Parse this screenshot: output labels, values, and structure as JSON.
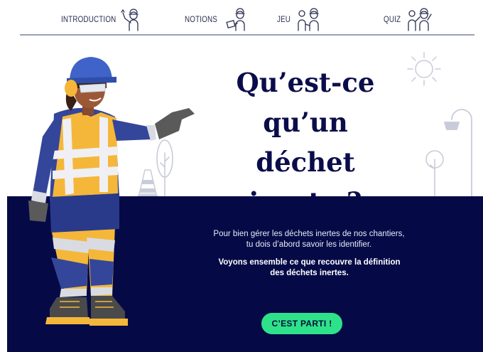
{
  "nav": {
    "items": [
      {
        "label": "INTRODUCTION",
        "icon": "worker-waving-icon"
      },
      {
        "label": "NOTIONS",
        "icon": "worker-clipboard-icon"
      },
      {
        "label": "JEU",
        "icon": "workers-game-icon"
      },
      {
        "label": "QUIZ",
        "icon": "workers-quiz-icon"
      }
    ]
  },
  "hero": {
    "title_line1": "Qu’est-ce",
    "title_line2": "qu’un déchet",
    "title_line3": "inerte ?"
  },
  "band": {
    "intro_line1": "Pour bien gérer les déchets inertes de nos chantiers,",
    "intro_line2": "tu dois d’abord savoir les identifier.",
    "emph_line1": "Voyons ensemble ce que recouvre la définition",
    "emph_line2": "des déchets inertes.",
    "cta_label": "C’EST PARTI !"
  },
  "colors": {
    "navy": "#050a47",
    "title": "#0b0d4a",
    "cta": "#2ee28a",
    "safety_vest": "#f5b73a",
    "helmet": "#3f63c8"
  }
}
